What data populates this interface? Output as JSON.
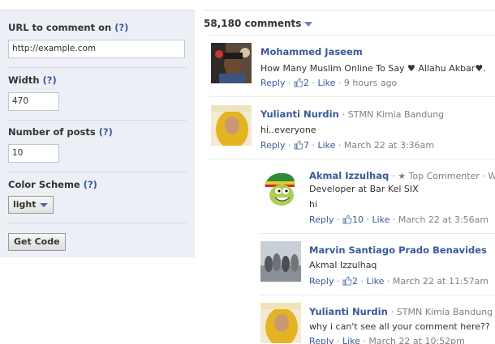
{
  "settings": {
    "url_label": "URL to comment on",
    "url_help": "(?)",
    "url_value": "http://example.com",
    "width_label": "Width",
    "width_help": "(?)",
    "width_value": "470",
    "posts_label": "Number of posts",
    "posts_help": "(?)",
    "posts_value": "10",
    "color_label": "Color Scheme",
    "color_help": "(?)",
    "color_value": "light",
    "get_code": "Get Code"
  },
  "comments_header": {
    "count": "58,180 comments"
  },
  "comments": [
    {
      "name": "Mohammed Jaseem",
      "meta": "",
      "text": "How Many Muslim Online To Say ♥ Allahu Akbar♥.",
      "reply": "Reply",
      "likes": "2",
      "like": "Like",
      "time": "9 hours ago"
    },
    {
      "name": "Yulianti Nurdin",
      "meta": "· STMN Kimia Bandung",
      "text": "hi..everyone",
      "reply": "Reply",
      "likes": "7",
      "like": "Like",
      "time": "March 22 at 3:36am"
    },
    {
      "name": "Akmal Izzulhaq",
      "meta": "· ★ Top Commenter · Web D",
      "meta2": "Developer at Bar Kel SIX",
      "text": "hi",
      "reply": "Reply",
      "likes": "10",
      "like": "Like",
      "time": "March 22 at 3:56am"
    },
    {
      "name": "Marvin Santiago Prado Benavides",
      "meta": "",
      "text": "Akmal Izzulhaq",
      "reply": "Reply",
      "likes": "2",
      "like": "Like",
      "time": "March 22 at 11:57am"
    },
    {
      "name": "Yulianti Nurdin",
      "meta": "· STMN Kimia Bandung",
      "text": "why i can't see all your comment here??",
      "reply": "Reply",
      "like": "Like",
      "time": "March 22 at 10:52pm"
    }
  ],
  "colors": {
    "link": "#3b5998",
    "panel": "#eceff5",
    "muted": "#808080"
  }
}
